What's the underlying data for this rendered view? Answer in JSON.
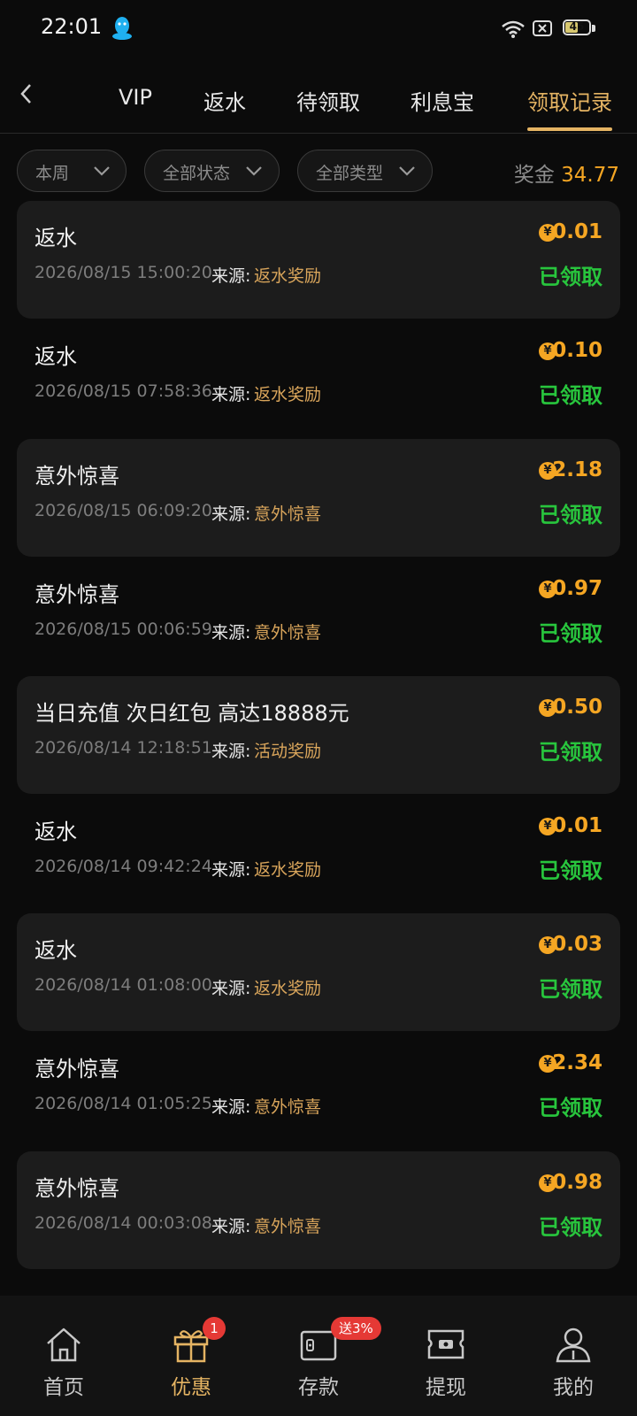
{
  "status_bar": {
    "time": "22:01",
    "battery": "45"
  },
  "tabs": [
    {
      "label": "VIP",
      "active": false
    },
    {
      "label": "返水",
      "active": false
    },
    {
      "label": "待领取",
      "active": false
    },
    {
      "label": "利息宝",
      "active": false
    },
    {
      "label": "领取记录",
      "active": true
    }
  ],
  "filters": {
    "period": "本周",
    "status": "全部状态",
    "type": "全部类型"
  },
  "bonus": {
    "label": "奖金",
    "amount": "34.77"
  },
  "source_label": "来源:",
  "currency_symbol": "¥",
  "records": [
    {
      "title": "返水",
      "date": "2026/08/15 15:00:20",
      "source": "返水奖励",
      "amount": "0.01",
      "status": "已领取"
    },
    {
      "title": "返水",
      "date": "2026/08/15 07:58:36",
      "source": "返水奖励",
      "amount": "0.10",
      "status": "已领取"
    },
    {
      "title": "意外惊喜",
      "date": "2026/08/15 06:09:20",
      "source": "意外惊喜",
      "amount": "2.18",
      "status": "已领取"
    },
    {
      "title": "意外惊喜",
      "date": "2026/08/15 00:06:59",
      "source": "意外惊喜",
      "amount": "0.97",
      "status": "已领取"
    },
    {
      "title": "当日充值 次日红包 高达18888元",
      "date": "2026/08/14 12:18:51",
      "source": "活动奖励",
      "amount": "0.50",
      "status": "已领取"
    },
    {
      "title": "返水",
      "date": "2026/08/14 09:42:24",
      "source": "返水奖励",
      "amount": "0.01",
      "status": "已领取"
    },
    {
      "title": "返水",
      "date": "2026/08/14 01:08:00",
      "source": "返水奖励",
      "amount": "0.03",
      "status": "已领取"
    },
    {
      "title": "意外惊喜",
      "date": "2026/08/14 01:05:25",
      "source": "意外惊喜",
      "amount": "2.34",
      "status": "已领取"
    },
    {
      "title": "意外惊喜",
      "date": "2026/08/14 00:03:08",
      "source": "意外惊喜",
      "amount": "0.98",
      "status": "已领取"
    }
  ],
  "bottom_nav": [
    {
      "label": "首页",
      "icon": "home-icon",
      "active": false
    },
    {
      "label": "优惠",
      "icon": "gift-icon",
      "active": true,
      "badge": "1"
    },
    {
      "label": "存款",
      "icon": "wallet-icon",
      "active": false,
      "badge": "送3%"
    },
    {
      "label": "提现",
      "icon": "ticket-icon",
      "active": false
    },
    {
      "label": "我的",
      "icon": "user-icon",
      "active": false
    }
  ],
  "colors": {
    "accent": "#e5b463",
    "amount": "#f5a623",
    "claimed": "#28c53d",
    "source": "#d9a55b",
    "badge": "#e53935"
  }
}
